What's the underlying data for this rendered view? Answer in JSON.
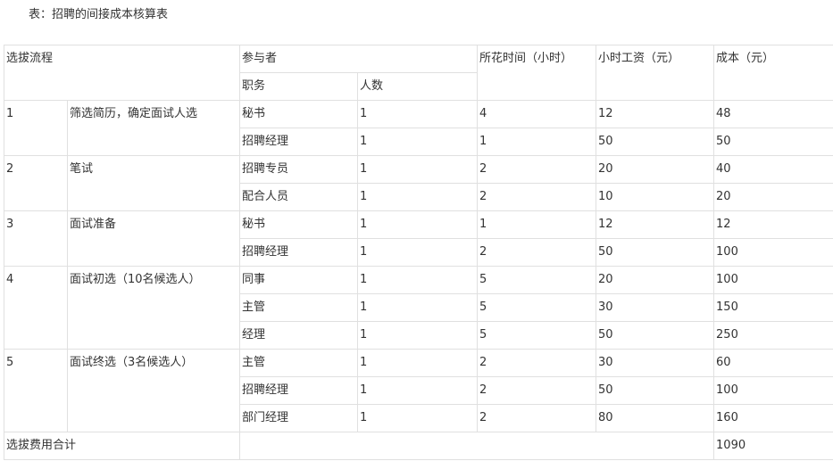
{
  "caption": "表：招聘的间接成本核算表",
  "headers": {
    "process": "选拔流程",
    "participants": "参与者",
    "position": "职务",
    "count": "人数",
    "hours": "所花时间（小时）",
    "wage": "小时工资（元）",
    "cost": "成本（元）"
  },
  "groups": [
    {
      "num": "1",
      "step": "筛选简历，确定面试人选",
      "rows": [
        {
          "position": "秘书",
          "count": "1",
          "hours": "4",
          "wage": "12",
          "cost": "48"
        },
        {
          "position": "招聘经理",
          "count": "1",
          "hours": "1",
          "wage": "50",
          "cost": "50"
        }
      ]
    },
    {
      "num": "2",
      "step": "笔试",
      "rows": [
        {
          "position": "招聘专员",
          "count": "1",
          "hours": "2",
          "wage": "20",
          "cost": "40"
        },
        {
          "position": "配合人员",
          "count": "1",
          "hours": "2",
          "wage": "10",
          "cost": "20"
        }
      ]
    },
    {
      "num": "3",
      "step": "面试准备",
      "rows": [
        {
          "position": "秘书",
          "count": "1",
          "hours": "1",
          "wage": "12",
          "cost": "12"
        },
        {
          "position": "招聘经理",
          "count": "1",
          "hours": "2",
          "wage": "50",
          "cost": "100"
        }
      ]
    },
    {
      "num": "4",
      "step": "面试初选（10名候选人）",
      "rows": [
        {
          "position": "同事",
          "count": "1",
          "hours": "5",
          "wage": "20",
          "cost": "100"
        },
        {
          "position": "主管",
          "count": "1",
          "hours": "5",
          "wage": "30",
          "cost": "150"
        },
        {
          "position": "经理",
          "count": "1",
          "hours": "5",
          "wage": "50",
          "cost": "250"
        }
      ]
    },
    {
      "num": "5",
      "step": "面试终选（3名候选人）",
      "rows": [
        {
          "position": "主管",
          "count": "1",
          "hours": "2",
          "wage": "30",
          "cost": "60"
        },
        {
          "position": "招聘经理",
          "count": "1",
          "hours": "2",
          "wage": "50",
          "cost": "100"
        },
        {
          "position": "部门经理",
          "count": "1",
          "hours": "2",
          "wage": "80",
          "cost": "160"
        }
      ]
    }
  ],
  "total": {
    "label": "选拔费用合计",
    "value": "1090"
  }
}
